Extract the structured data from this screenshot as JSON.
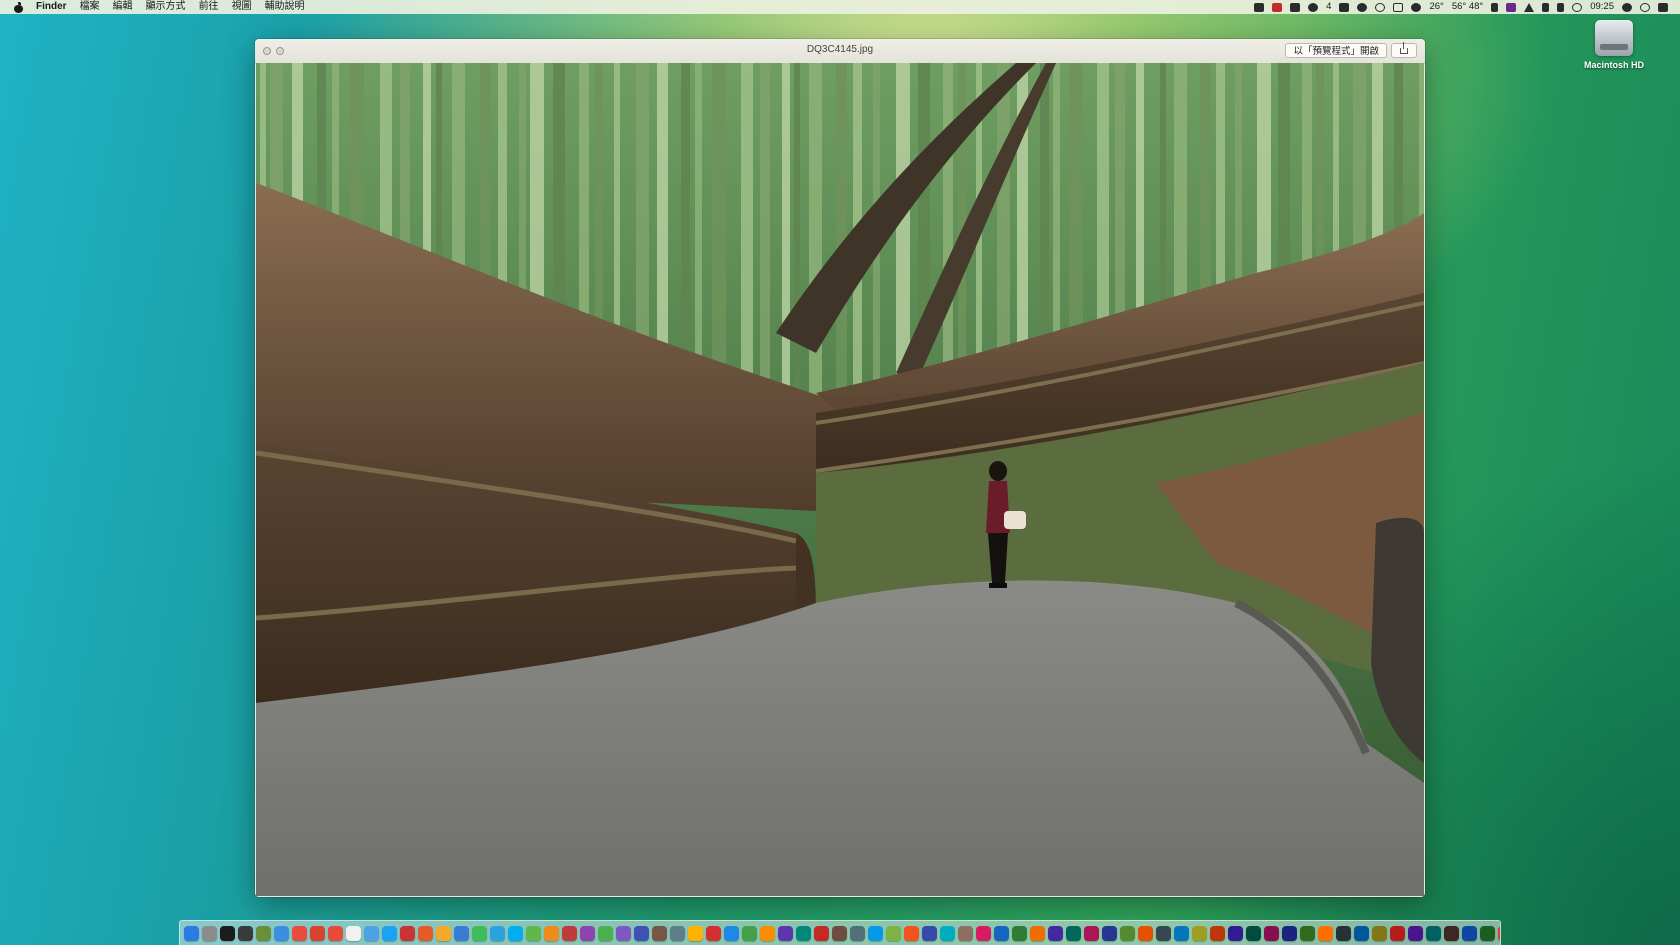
{
  "menubar": {
    "app_name": "Finder",
    "menus": [
      "檔案",
      "編輯",
      "顯示方式",
      "前往",
      "視圖",
      "輔助說明"
    ],
    "status": {
      "notification_count": "4",
      "temperature": "26°",
      "temp_range": "56° 48°",
      "clock": "09:25"
    }
  },
  "desktop": {
    "drive_label": "Macintosh HD"
  },
  "quicklook": {
    "title": "DQ3C4145.jpg",
    "open_with_label": "以「預覽程式」開啟"
  },
  "dock": {
    "app_colors": [
      "#2a7be4",
      "#8c8c8c",
      "#1c1c1c",
      "#3a3a3a",
      "#6b8e3a",
      "#3b8fe0",
      "#e94b3c",
      "#d8432e",
      "#e84a3a",
      "#f1f1f1",
      "#4da2e6",
      "#1da1f2",
      "#cc3333",
      "#e65a2a",
      "#f3a92b",
      "#3a7bd5",
      "#3ebd5a",
      "#2aa3e0",
      "#00aff0",
      "#5fb64a",
      "#f08a1c",
      "#c03b3b",
      "#8e44ad",
      "#4caf50",
      "#7e57c2",
      "#3f51b5",
      "#795548",
      "#607d8b",
      "#ffb300",
      "#d32f2f",
      "#1e88e5",
      "#43a047",
      "#fb8c00",
      "#5e35b1",
      "#00897b",
      "#c62828",
      "#6d4c41",
      "#546e7a",
      "#039be5",
      "#7cb342",
      "#f4511e",
      "#3949ab",
      "#00acc1",
      "#8d6e63",
      "#d81b60",
      "#1565c0",
      "#2e7d32",
      "#ef6c00",
      "#4527a0",
      "#00695c",
      "#ad1457",
      "#283593",
      "#558b2f",
      "#e65100",
      "#37474f",
      "#0277bd",
      "#9e9d24",
      "#bf360c",
      "#311b92",
      "#004d40",
      "#880e4f",
      "#1a237e",
      "#33691e",
      "#ff6f00",
      "#263238",
      "#01579b",
      "#827717",
      "#b71c1c",
      "#4a148c",
      "#006064",
      "#3e2723",
      "#0d47a1",
      "#1b5e20",
      "#e53935",
      "#263a7c",
      "#f2c14e",
      "#2d6d9a",
      "#a83279"
    ],
    "folder_colors": [
      "#62a8e5",
      "#62a8e5",
      "#62a8e5",
      "#62a8e5",
      "#62a8e5"
    ],
    "trash_color": "#cfd6d8"
  }
}
